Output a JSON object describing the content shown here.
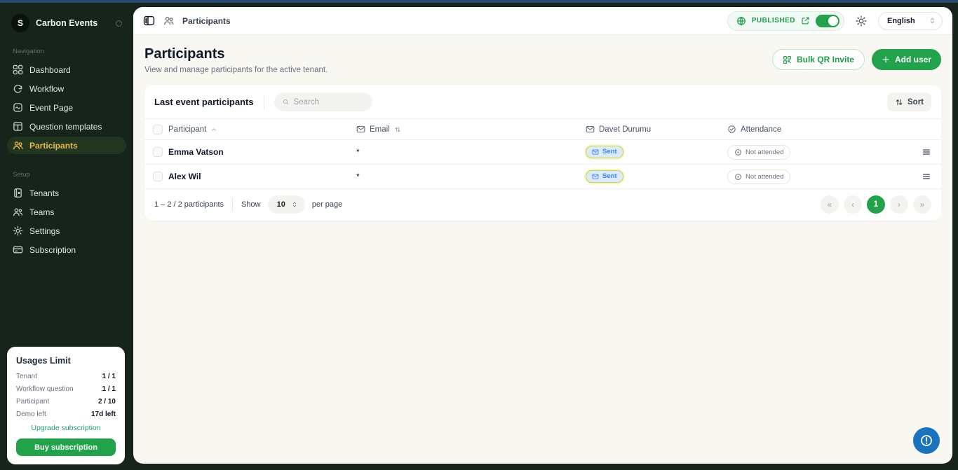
{
  "app": {
    "brand": "Carbon Events",
    "logo_letter": "S"
  },
  "sidebar": {
    "sections": [
      {
        "label": "Navigation",
        "items": [
          {
            "label": "Dashboard"
          },
          {
            "label": "Workflow"
          },
          {
            "label": "Event Page"
          },
          {
            "label": "Question templates"
          },
          {
            "label": "Participants"
          }
        ]
      },
      {
        "label": "Setup",
        "items": [
          {
            "label": "Tenants"
          },
          {
            "label": "Teams"
          },
          {
            "label": "Settings"
          },
          {
            "label": "Subscription"
          }
        ]
      }
    ],
    "usage_card": {
      "title": "Usages Limit",
      "rows": [
        {
          "label": "Tenant",
          "value": "1 / 1"
        },
        {
          "label": "Workflow question",
          "value": "1 / 1"
        },
        {
          "label": "Participant",
          "value": "2 / 10"
        },
        {
          "label": "Demo left",
          "value": "17d left"
        }
      ],
      "upgrade_link": "Upgrade subscription",
      "buy_button": "Buy subscription"
    }
  },
  "topbar": {
    "breadcrumb": "Participants",
    "published_label": "PUBLISHED",
    "language_value": "English"
  },
  "page": {
    "title": "Participants",
    "subtitle": "View and manage participants for the active tenant.",
    "bulk_qr_label": "Bulk QR Invite",
    "add_user_label": "Add user"
  },
  "table": {
    "title": "Last event participants",
    "search_placeholder": "Search",
    "sort_label": "Sort",
    "headers": {
      "participant": "Participant",
      "email": "Email",
      "invite": "Davet Durumu",
      "attendance": "Attendance"
    },
    "rows": [
      {
        "name": "Emma Vatson",
        "email": "*",
        "invite_status": "Sent",
        "attendance": "Not attended"
      },
      {
        "name": "Alex Wil",
        "email": "*",
        "invite_status": "Sent",
        "attendance": "Not attended"
      }
    ],
    "footer": {
      "range_text": "1 – 2 / 2 participants",
      "show_label": "Show",
      "page_size": "10",
      "per_page_label": "per page"
    },
    "pagination": {
      "first": "«",
      "prev": "‹",
      "page": "1",
      "next": "›",
      "last": "»"
    }
  },
  "colors": {
    "sidebar_bg": "#16241b",
    "accent_green": "#21a24b",
    "active_item_gold": "#e9b949",
    "content_bg": "#f8f7f2",
    "published_green": "#1d9e4b",
    "sent_badge_blue": "#3b82f6",
    "sent_badge_ring": "#cddc39",
    "help_button_blue": "#1a73bd",
    "top_strip_navy": "#2b4a72"
  }
}
